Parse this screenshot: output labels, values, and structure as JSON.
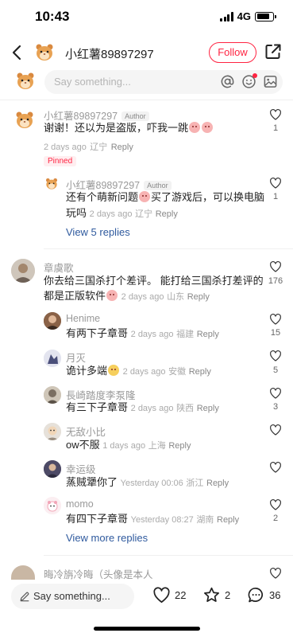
{
  "status_bar": {
    "time": "10:43",
    "network": "4G"
  },
  "header": {
    "user_name": "小红薯89897297",
    "follow_label": "Follow"
  },
  "comment_bar": {
    "placeholder": "Say something..."
  },
  "comments": [
    {
      "name": "小红薯89897297",
      "author_tag": "Author",
      "text": "谢谢！还以为是盗版，吓我一跳",
      "time": "2 days ago",
      "location": "辽宁",
      "reply_label": "Reply",
      "likes": "1",
      "pinned_label": "Pinned",
      "replies": [
        {
          "name": "小红薯89897297",
          "author_tag": "Author",
          "text_line1": "还有个萌新问题",
          "text_line1b": "买了游戏后，可以换电脑",
          "text_line2": "玩吗",
          "time": "2 days ago",
          "location": "辽宁",
          "reply_label": "Reply",
          "likes": "1"
        }
      ],
      "view_replies": "View 5 replies"
    },
    {
      "name": "章虞歌",
      "text_line1": "你去给三国杀打个差评。 能打给三国杀打差评的",
      "text_line2": "都是正版软件",
      "time": "2 days ago",
      "location": "山东",
      "reply_label": "Reply",
      "likes": "176",
      "replies": [
        {
          "name": "Henime",
          "text": "有两下子章哥",
          "time": "2 days ago",
          "location": "福建",
          "reply_label": "Reply",
          "likes": "15"
        },
        {
          "name": "月灭",
          "text": "诡计多端",
          "time": "2 days ago",
          "location": "安徽",
          "reply_label": "Reply",
          "likes": "5"
        },
        {
          "name": "長崎踏度李泵隆",
          "text": "有三下子章哥",
          "time": "2 days ago",
          "location": "陕西",
          "reply_label": "Reply",
          "likes": "3"
        },
        {
          "name": "无敌小比",
          "text": "ow不服",
          "time": "1 days ago",
          "location": "上海",
          "reply_label": "Reply",
          "likes": ""
        },
        {
          "name": "幸运级",
          "text": "蒸贼犟你了",
          "time": "Yesterday 00:06",
          "location": "浙江",
          "reply_label": "Reply",
          "likes": ""
        },
        {
          "name": "momo",
          "text": "有四下子章哥",
          "time": "Yesterday 08:27",
          "location": "湖南",
          "reply_label": "Reply",
          "likes": "2"
        }
      ],
      "view_more": "View more replies"
    },
    {
      "name": "晦冷旃冷晦（头像是本人"
    }
  ],
  "bottom_bar": {
    "placeholder": "Say something...",
    "likes": "22",
    "favorites": "2",
    "comments": "36"
  },
  "colors": {
    "accent": "#ff2442",
    "link": "#2f5a9e"
  }
}
